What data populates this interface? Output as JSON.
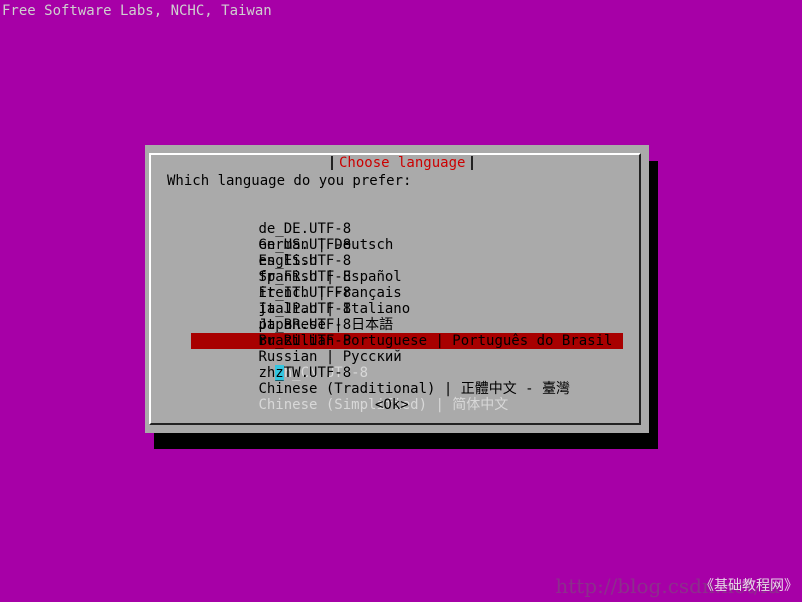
{
  "screen": {
    "background_color": "#a700a7",
    "header_text": "Free Software Labs, NCHC, Taiwan"
  },
  "dialog": {
    "title": "Choose language",
    "prompt": "Which language do you prefer:",
    "items": [
      {
        "code": "de_DE.UTF-8",
        "label": "German | Deutsch"
      },
      {
        "code": "en_US.UTF-8",
        "label": "English"
      },
      {
        "code": "es_ES.UTF-8",
        "label": "Spanish | Español"
      },
      {
        "code": "fr_FR.UTF-8",
        "label": "French | Français"
      },
      {
        "code": "it_IT.UTF-8",
        "label": "Italian | Italiano"
      },
      {
        "code": "ja_JP.UTF-8",
        "label": "Japanese | 日本語"
      },
      {
        "code": "pt_BR.UTF-8",
        "label": "Brazilian Portuguese | Português do Brasil"
      },
      {
        "code": "ru_RU.UTF-8",
        "label": "Russian | Русский"
      },
      {
        "code": "zh_CN.UTF-8",
        "label": "Chinese (Simplified) | 简体中文",
        "selected": true
      },
      {
        "code": "zh_TW.UTF-8",
        "label": "Chinese (Traditional) | 正體中文 - 臺灣"
      }
    ],
    "selected_index": 8,
    "ok_label": "<Ok>"
  },
  "watermark": {
    "url": "http://blog.csdn.net/lu",
    "tag": "《基础教程网》"
  },
  "colors": {
    "dialog_bg": "#aaaaaa",
    "title_text": "#cc0000",
    "selection_bg": "#a80000",
    "cursor_bg": "#33c5e0"
  }
}
